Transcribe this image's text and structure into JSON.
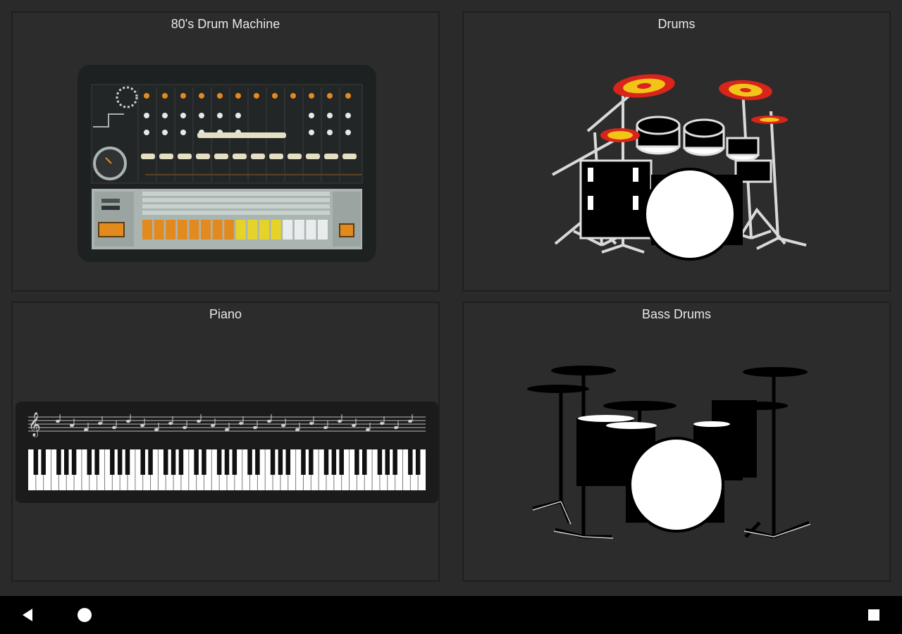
{
  "tiles": [
    {
      "title": "80's Drum Machine",
      "icon": "drum-machine-icon"
    },
    {
      "title": "Drums",
      "icon": "drum-kit-icon"
    },
    {
      "title": "Piano",
      "icon": "piano-keyboard-icon"
    },
    {
      "title": "Bass Drums",
      "icon": "bass-drum-kit-icon"
    }
  ],
  "navbar": {
    "back": "back-icon",
    "home": "home-icon",
    "recents": "recents-icon"
  },
  "colors": {
    "background": "#2a2a2a",
    "tile": "#2c2c2c",
    "title_text": "#e8e8e8",
    "accent_orange": "#e38a1f",
    "accent_yellow": "#e6d32a",
    "cymbal_red": "#d8241a",
    "cymbal_yellow": "#f3c418"
  }
}
